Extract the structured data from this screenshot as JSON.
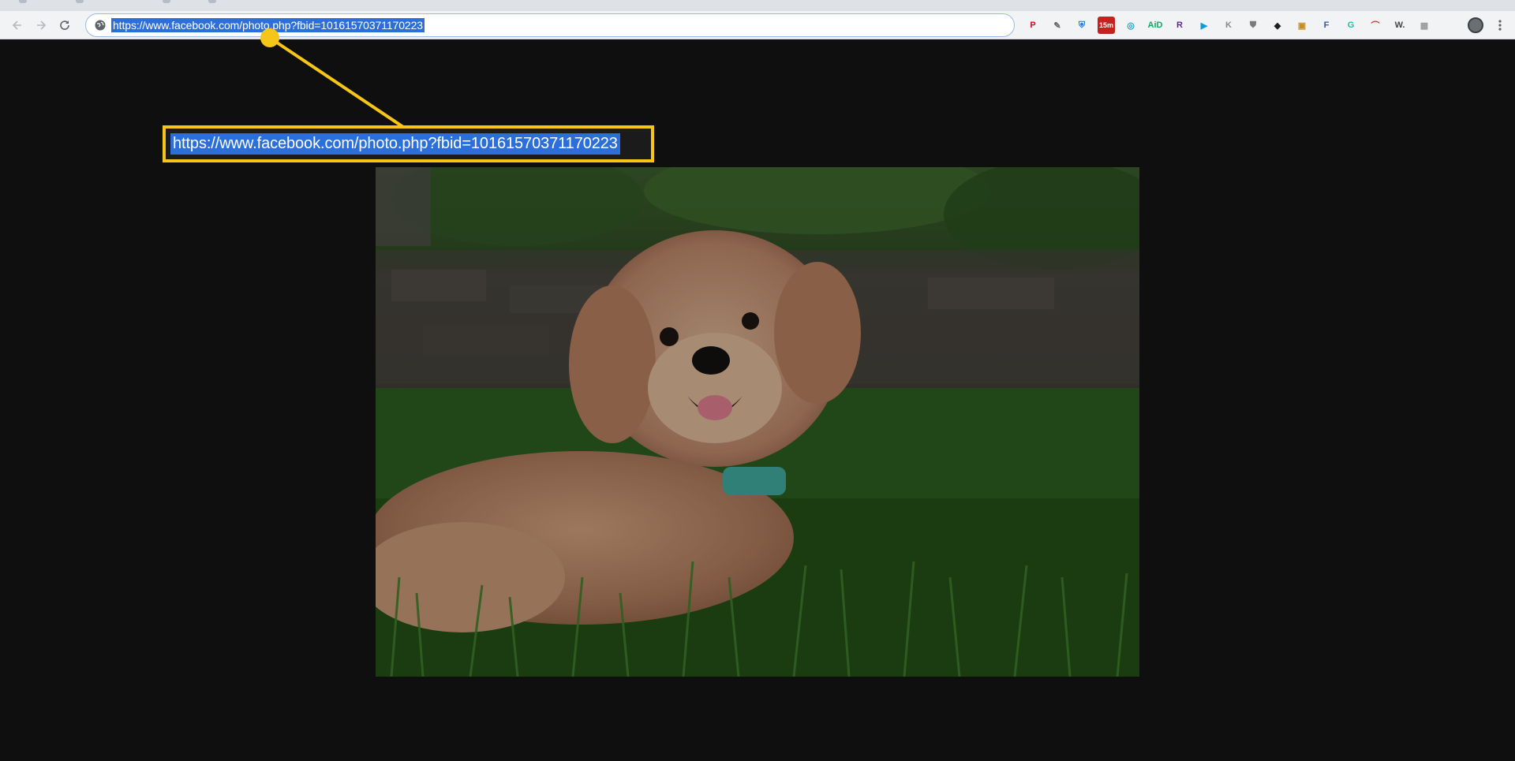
{
  "browser": {
    "address_bar": {
      "url": "https://www.facebook.com/photo.php?fbid=10161570371170223"
    },
    "toolbar": {
      "back_icon": "arrow-left-icon",
      "forward_icon": "arrow-right-icon",
      "reload_icon": "reload-icon",
      "menu_icon": "kebab-menu-icon"
    },
    "extensions": [
      {
        "name": "pinterest-icon",
        "glyph": "P",
        "color": "#e60023"
      },
      {
        "name": "eyedropper-icon",
        "glyph": "✎",
        "color": "#5f6368"
      },
      {
        "name": "shield-icon",
        "glyph": "⛨",
        "color": "#1a73e8"
      },
      {
        "name": "timer-icon",
        "glyph": "15m",
        "color": "#c5221f"
      },
      {
        "name": "compass-icon",
        "glyph": "◎",
        "color": "#1aa3c4"
      },
      {
        "name": "aid-icon",
        "glyph": "AiD",
        "color": "#16a765"
      },
      {
        "name": "r-icon",
        "glyph": "R",
        "color": "#5b2a86"
      },
      {
        "name": "tag-icon",
        "glyph": "▶",
        "color": "#0f9bd7"
      },
      {
        "name": "k-icon",
        "glyph": "K",
        "color": "#8a8a8a"
      },
      {
        "name": "badge-icon",
        "glyph": "⛊",
        "color": "#7a7a7a"
      },
      {
        "name": "owl-icon",
        "glyph": "◆",
        "color": "#1f1f1f"
      },
      {
        "name": "box-icon",
        "glyph": "▣",
        "color": "#c98a1f"
      },
      {
        "name": "f-icon",
        "glyph": "F",
        "color": "#2c5aa0"
      },
      {
        "name": "grammarly-icon",
        "glyph": "G",
        "color": "#15c39a"
      },
      {
        "name": "pepper-icon",
        "glyph": "⌒",
        "color": "#d93025"
      },
      {
        "name": "w-icon",
        "glyph": "W.",
        "color": "#444"
      },
      {
        "name": "grid-icon",
        "glyph": "▦",
        "color": "#9a9a9a"
      }
    ]
  },
  "callout": {
    "text": "https://www.facebook.com/photo.php?fbid=10161570371170223",
    "accent": "#f5c518",
    "selection_color": "#2d6fd9"
  },
  "photo": {
    "subject": "photo"
  }
}
